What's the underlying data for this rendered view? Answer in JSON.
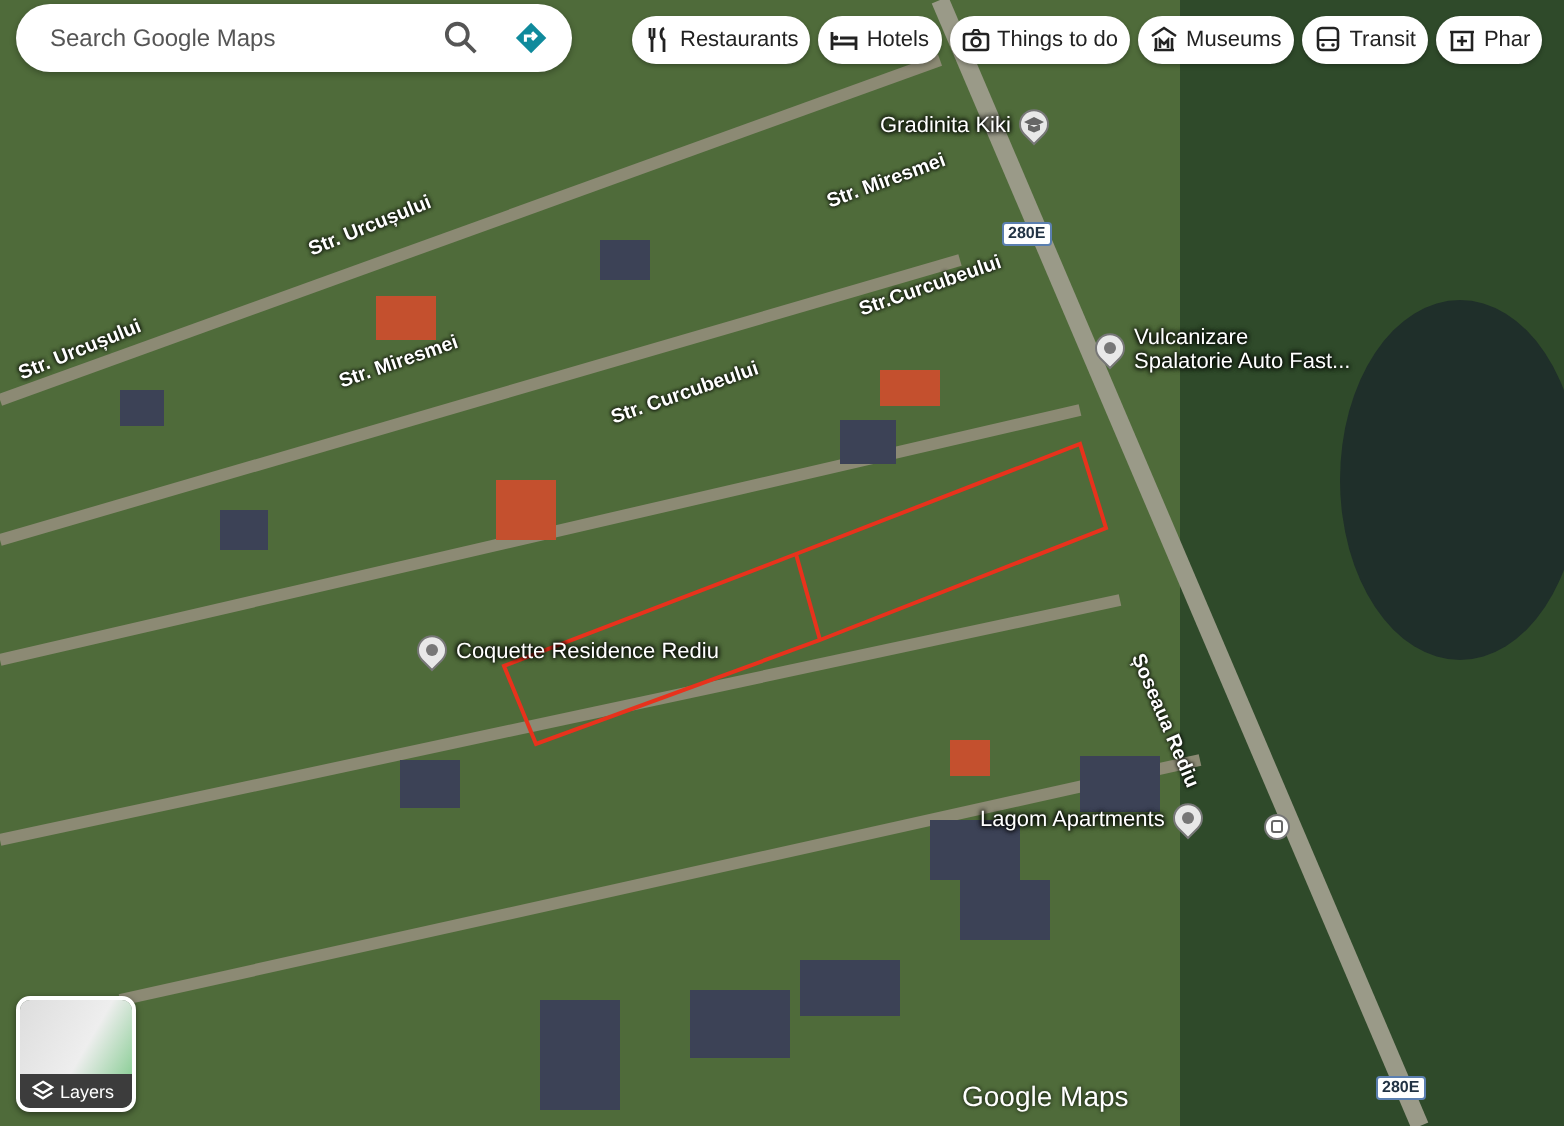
{
  "search": {
    "placeholder": "Search Google Maps"
  },
  "chips": [
    {
      "label": "Restaurants"
    },
    {
      "label": "Hotels"
    },
    {
      "label": "Things to do"
    },
    {
      "label": "Museums"
    },
    {
      "label": "Transit"
    },
    {
      "label": "Phar"
    }
  ],
  "map_labels": [
    {
      "kind": "street",
      "text": "Str. Urcușului"
    },
    {
      "kind": "street",
      "text": "Str. Urcușului"
    },
    {
      "kind": "street",
      "text": "Str. Miresmei"
    },
    {
      "kind": "street",
      "text": "Str. Miresmei"
    },
    {
      "kind": "street",
      "text": "Str. Curcubeului"
    },
    {
      "kind": "street",
      "text": "Str.Curcubeului"
    },
    {
      "kind": "street",
      "text": "Șoseaua Rediu"
    },
    {
      "kind": "school",
      "text": "Gradinita Kiki"
    },
    {
      "kind": "place",
      "text": "Vulcanizare\nSpalatorie Auto Fast..."
    },
    {
      "kind": "place",
      "text": "Coquette Residence Rediu"
    },
    {
      "kind": "place",
      "text": "Lagom Apartments"
    },
    {
      "kind": "shield",
      "text": "280E"
    },
    {
      "kind": "shield",
      "text": "280E"
    }
  ],
  "layers": {
    "label": "Layers"
  },
  "logo": "Google Maps"
}
